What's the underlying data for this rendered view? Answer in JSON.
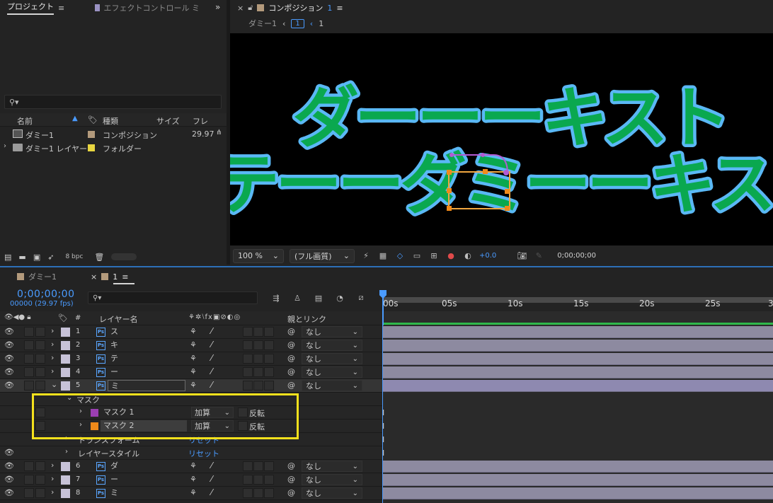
{
  "project_panel": {
    "tab_project": "プロジェクト",
    "tab_effects": "エフェクトコントロール ミ",
    "search_placeholder": "",
    "columns": {
      "name": "名前",
      "type": "種類",
      "size": "サイズ",
      "frame": "フレ"
    },
    "items": [
      {
        "name": "ダミー1",
        "type": "コンポジション",
        "frame": "29.97",
        "label_color": "#b39a7c"
      },
      {
        "name": "ダミー1 レイヤー",
        "type": "フォルダー",
        "frame": "",
        "label_color": "#e8d640"
      }
    ],
    "bpc": "8 bpc"
  },
  "comp_panel": {
    "title": "コンポジション",
    "title_num": "1",
    "breadcrumb_parent": "ダミー1",
    "breadcrumb_current": "1",
    "breadcrumb_next": "1",
    "canvas_line1": "ダーーーキスト",
    "canvas_line2": "テーーダミーーキス",
    "zoom": "100 %",
    "quality": "(フル画質)",
    "exposure": "+0.0",
    "timecode": "0;00;00;00"
  },
  "timeline": {
    "tab_inactive": "ダミー1",
    "tab_active": "1",
    "timecode": "0;00;00;00",
    "fps": "00000 (29.97 fps)",
    "col_layer_name": "レイヤー名",
    "col_parent": "親とリンク",
    "ruler": [
      "00s",
      "05s",
      "10s",
      "15s",
      "20s",
      "25s",
      "3"
    ],
    "layers": [
      {
        "num": "1",
        "name": "ス",
        "parent": "なし"
      },
      {
        "num": "2",
        "name": "キ",
        "parent": "なし"
      },
      {
        "num": "3",
        "name": "テ",
        "parent": "なし"
      },
      {
        "num": "4",
        "name": "ー",
        "parent": "なし"
      },
      {
        "num": "5",
        "name": "ミ",
        "parent": "なし"
      }
    ],
    "mask_group": "マスク",
    "masks": [
      {
        "name": "マスク 1",
        "mode": "加算",
        "invert": "反転",
        "color": "#9b3fb3"
      },
      {
        "name": "マスク 2",
        "mode": "加算",
        "invert": "反転",
        "color": "#ef8a1a"
      }
    ],
    "transform": "トランスフォーム",
    "transform_reset": "リセット",
    "layer_style": "レイヤースタイル",
    "layer_style_reset": "リセット",
    "layers_after": [
      {
        "num": "6",
        "name": "ダ",
        "parent": "なし"
      },
      {
        "num": "7",
        "name": "ー",
        "parent": "なし"
      },
      {
        "num": "8",
        "name": "ミ",
        "parent": "なし"
      }
    ]
  },
  "colors": {
    "accent": "#4a9bff",
    "highlight_box": "#f5e11c",
    "text_fill": "#0aa84f",
    "text_stroke": "#5ab8f5"
  }
}
